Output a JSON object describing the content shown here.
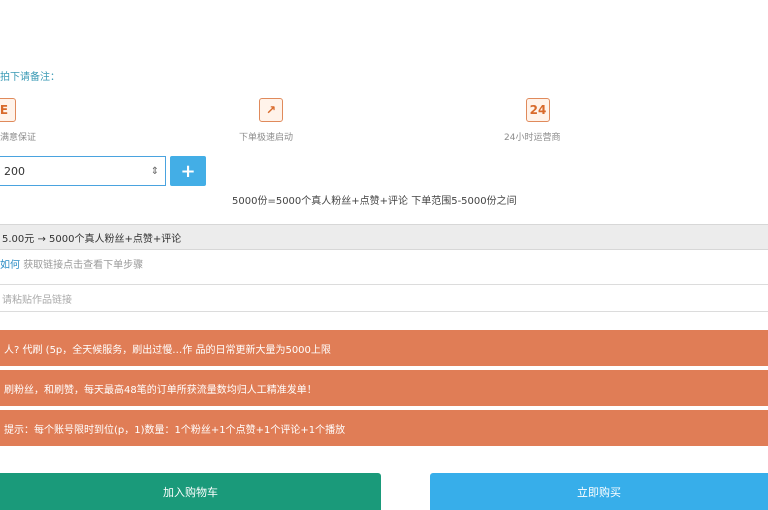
{
  "header": {
    "hint": "拍下请备注："
  },
  "features": [
    {
      "icon": "E",
      "label": "满意保证"
    },
    {
      "icon": "↗",
      "label": "下单极速启动"
    },
    {
      "icon": "24",
      "label": "24小时运营商"
    }
  ],
  "quantity": {
    "value": "200",
    "spin": "⇕",
    "plus": "+"
  },
  "description": "5000份=5000个真人粉丝+点赞+评论 下单范围5-5000份之间",
  "spec": {
    "label": "5.00元 → 5000个真人粉丝+点赞+评论"
  },
  "link_hint": {
    "link_text": "如何",
    "rest": "获取链接点击查看下单步骤"
  },
  "link_input": {
    "placeholder": "请粘贴作品链接"
  },
  "notices": [
    "人? 代刷 (5p，全天候服务，刷出过慢…作 品的日常更新大量为5000上限",
    "刷粉丝，和刷赞，每天最高48笔的订单所获流量数均归人工精准发单！",
    "提示：每个账号限时到位(p，1)数量：1个粉丝+1个点赞+1个评论+1个播放"
  ],
  "buttons": {
    "add_to_cart": "加入购物车",
    "buy_now": "立即购买"
  }
}
